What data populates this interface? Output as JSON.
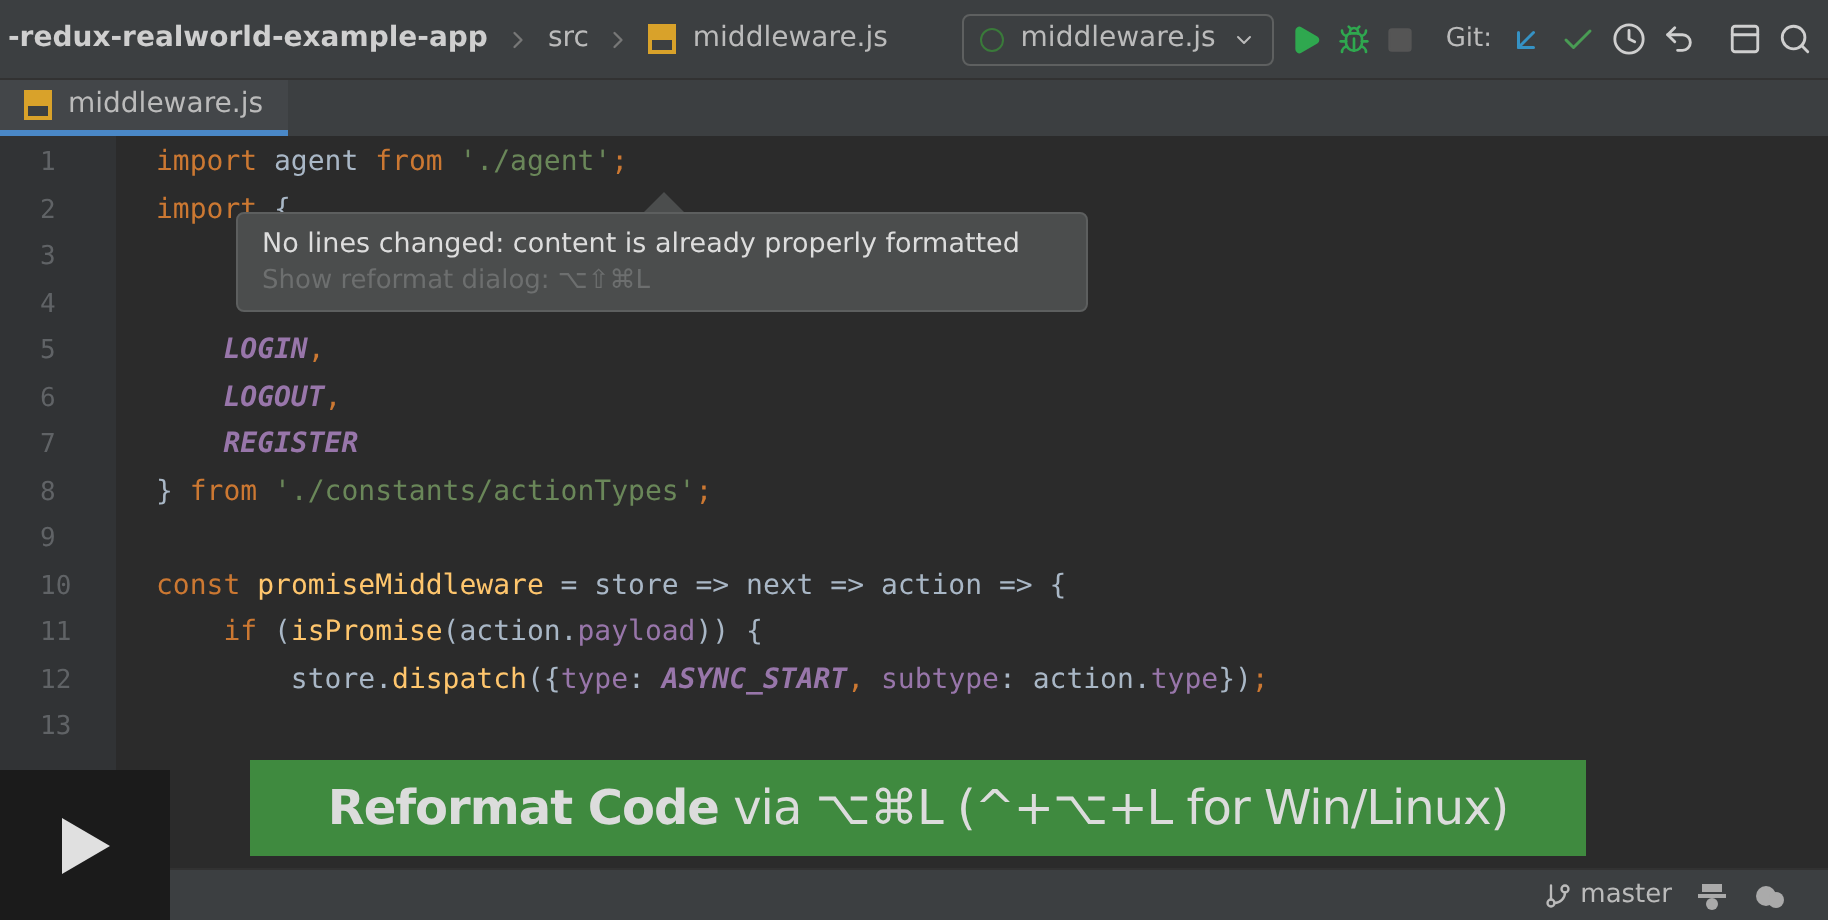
{
  "breadcrumbs": [
    "-redux-realworld-example-app",
    "src",
    "middleware.js"
  ],
  "run_config": {
    "label": "middleware.js"
  },
  "git_label": "Git:",
  "tabs": [
    {
      "label": "middleware.js",
      "selected": true
    }
  ],
  "code_lines": [
    {
      "number": "1",
      "tokens": [
        {
          "kind": "kw",
          "text": "import"
        },
        {
          "kind": "plain",
          "text": " agent "
        },
        {
          "kind": "kw",
          "text": "from"
        },
        {
          "kind": "str",
          "text": " './agent'"
        },
        {
          "kind": "kw",
          "text": ";"
        }
      ]
    },
    {
      "number": "2",
      "tokens": [
        {
          "kind": "kw",
          "text": "import"
        },
        {
          "kind": "plain",
          "text": " {"
        }
      ]
    },
    {
      "number": "3"
    },
    {
      "number": "4"
    },
    {
      "number": "5",
      "tokens": [
        {
          "kind": "const",
          "text": "    LOGIN"
        },
        {
          "kind": "kw",
          "text": ","
        }
      ]
    },
    {
      "number": "6",
      "tokens": [
        {
          "kind": "const",
          "text": "    LOGOUT"
        },
        {
          "kind": "kw",
          "text": ","
        }
      ]
    },
    {
      "number": "7",
      "tokens": [
        {
          "kind": "const",
          "text": "    REGISTER"
        }
      ]
    },
    {
      "number": "8",
      "tokens": [
        {
          "kind": "plain",
          "text": "} "
        },
        {
          "kind": "kw",
          "text": "from"
        },
        {
          "kind": "str",
          "text": " './constants/actionTypes'"
        },
        {
          "kind": "kw",
          "text": ";"
        }
      ]
    },
    {
      "number": "9"
    },
    {
      "number": "10",
      "tokens": [
        {
          "kind": "kw",
          "text": "const"
        },
        {
          "kind": "fn",
          "text": " promiseMiddleware"
        },
        {
          "kind": "plain",
          "text": " = store => next => action => {"
        }
      ]
    },
    {
      "number": "11",
      "tokens": [
        {
          "kind": "kw",
          "text": "    if"
        },
        {
          "kind": "plain",
          "text": " ("
        },
        {
          "kind": "fn",
          "text": "isPromise"
        },
        {
          "kind": "plain",
          "text": "(action."
        },
        {
          "kind": "prop",
          "text": "payload"
        },
        {
          "kind": "plain",
          "text": ")) {"
        }
      ]
    },
    {
      "number": "12",
      "tokens": [
        {
          "kind": "plain",
          "text": "        store."
        },
        {
          "kind": "fn",
          "text": "dispatch"
        },
        {
          "kind": "plain",
          "text": "({"
        },
        {
          "kind": "prop",
          "text": "type"
        },
        {
          "kind": "plain",
          "text": ": "
        },
        {
          "kind": "const",
          "text": "ASYNC_START"
        },
        {
          "kind": "kw",
          "text": ","
        },
        {
          "kind": "prop",
          "text": " subtype"
        },
        {
          "kind": "plain",
          "text": ": action."
        },
        {
          "kind": "prop",
          "text": "type"
        },
        {
          "kind": "plain",
          "text": "})"
        },
        {
          "kind": "kw",
          "text": ";"
        }
      ]
    },
    {
      "number": "13"
    }
  ],
  "tooltip": {
    "message": "No lines changed: content is already properly formatted",
    "hint": "Show reformat dialog: ⌥⇧⌘L"
  },
  "banner": "**Reformat Code** via ⌥⌘L (^+⌥+L for Win/Linux)",
  "status_bar": {
    "branch": "master"
  }
}
